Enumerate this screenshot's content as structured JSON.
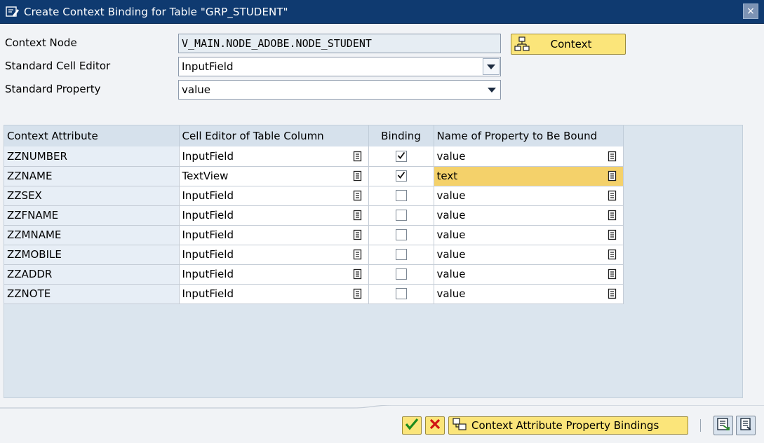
{
  "window": {
    "title": "Create Context Binding for Table \"GRP_STUDENT\"",
    "close_symbol": "×"
  },
  "form": {
    "context_node_label": "Context Node",
    "context_node_value": "V_MAIN.NODE_ADOBE.NODE_STUDENT",
    "cell_editor_label": "Standard Cell Editor",
    "cell_editor_value": "InputField",
    "property_label": "Standard Property",
    "property_value": "value",
    "context_button_label": "Context"
  },
  "table": {
    "headers": [
      "Context Attribute",
      "Cell Editor of Table Column",
      "Binding",
      "Name of Property to Be Bound"
    ],
    "rows": [
      {
        "attribute": "ZZNUMBER",
        "editor": "InputField",
        "binding": true,
        "property": "value",
        "highlight": false
      },
      {
        "attribute": "ZZNAME",
        "editor": "TextView",
        "binding": true,
        "property": "text",
        "highlight": true
      },
      {
        "attribute": "ZZSEX",
        "editor": "InputField",
        "binding": false,
        "property": "value",
        "highlight": false
      },
      {
        "attribute": "ZZFNAME",
        "editor": "InputField",
        "binding": false,
        "property": "value",
        "highlight": false
      },
      {
        "attribute": "ZZMNAME",
        "editor": "InputField",
        "binding": false,
        "property": "value",
        "highlight": false
      },
      {
        "attribute": "ZZMOBILE",
        "editor": "InputField",
        "binding": false,
        "property": "value",
        "highlight": false
      },
      {
        "attribute": "ZZADDR",
        "editor": "InputField",
        "binding": false,
        "property": "value",
        "highlight": false
      },
      {
        "attribute": "ZZNOTE",
        "editor": "InputField",
        "binding": false,
        "property": "value",
        "highlight": false
      }
    ]
  },
  "footer": {
    "bindings_button_label": "Context Attribute Property Bindings"
  },
  "colors": {
    "titlebar": "#0f3a70",
    "button_yellow": "#fbe57a",
    "highlight": "#f4d16a",
    "grid_bg": "#dbe5ee"
  },
  "icons": [
    "title-edit-icon",
    "close-icon",
    "hierarchy-icon",
    "dropdown-arrow-icon",
    "value-help-icon",
    "checkmark-icon",
    "cancel-x-icon",
    "bindings-icon",
    "local-layout-icon",
    "print-icon"
  ]
}
